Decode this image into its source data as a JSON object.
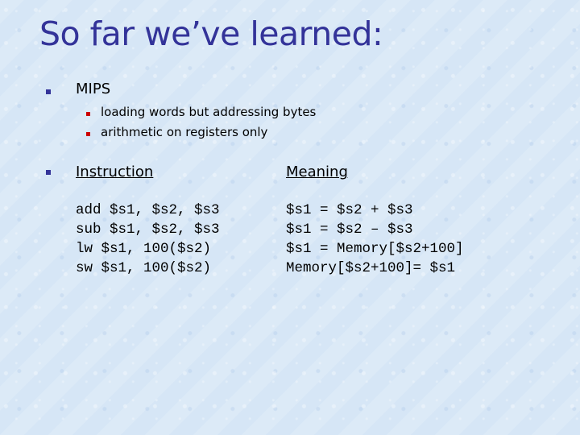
{
  "slide": {
    "title": "So far we’ve learned:",
    "bullets": [
      {
        "label": "MIPS",
        "sub": [
          "loading words but addressing bytes",
          "arithmetic on registers only"
        ]
      }
    ],
    "table": {
      "headers": {
        "instruction": "Instruction",
        "meaning": "Meaning"
      },
      "rows": [
        {
          "instruction": "add $s1, $s2, $s3",
          "meaning": "$s1 = $s2 + $s3"
        },
        {
          "instruction": "sub $s1, $s2, $s3",
          "meaning": "$s1 = $s2 – $s3"
        },
        {
          "instruction": "lw $s1, 100($s2)",
          "meaning": "$s1 = Memory[$s2+100]"
        },
        {
          "instruction": "sw $s1, 100($s2)",
          "meaning": "Memory[$s2+100]= $s1"
        }
      ]
    },
    "colors": {
      "title": "#333399",
      "bullet_level1": "#333399",
      "bullet_level2": "#cc0000",
      "background": "#d6e6f6"
    }
  }
}
